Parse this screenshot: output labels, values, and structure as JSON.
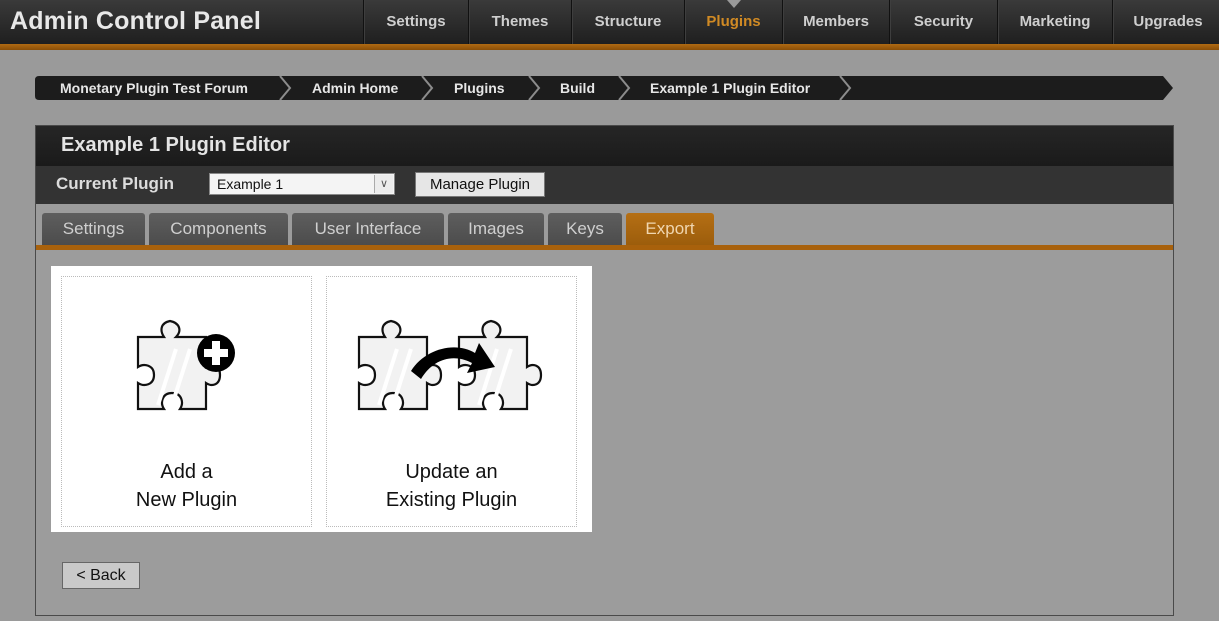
{
  "app": {
    "title": "Admin Control Panel"
  },
  "nav": {
    "items": [
      "Settings",
      "Themes",
      "Structure",
      "Plugins",
      "Members",
      "Security",
      "Marketing",
      "Upgrades"
    ],
    "active": "Plugins"
  },
  "breadcrumb": [
    "Monetary Plugin Test Forum",
    "Admin Home",
    "Plugins",
    "Build",
    "Example 1 Plugin Editor"
  ],
  "panel": {
    "title": "Example 1 Plugin Editor",
    "current_plugin_label": "Current Plugin",
    "current_plugin_value": "Example 1",
    "manage_button": "Manage Plugin"
  },
  "tabs": {
    "items": [
      "Settings",
      "Components",
      "User Interface",
      "Images",
      "Keys",
      "Export"
    ],
    "active": "Export"
  },
  "cards": {
    "add": {
      "line1": "Add a",
      "line2": "New Plugin",
      "icon": "puzzle-plus-icon"
    },
    "update": {
      "line1": "Update an",
      "line2": "Existing Plugin",
      "icon": "puzzle-arrow-icon"
    }
  },
  "back_button": "< Back",
  "colors": {
    "accent": "#a8610c",
    "header_bg": "#1f1f1f",
    "page_bg": "#9a9a9a"
  }
}
